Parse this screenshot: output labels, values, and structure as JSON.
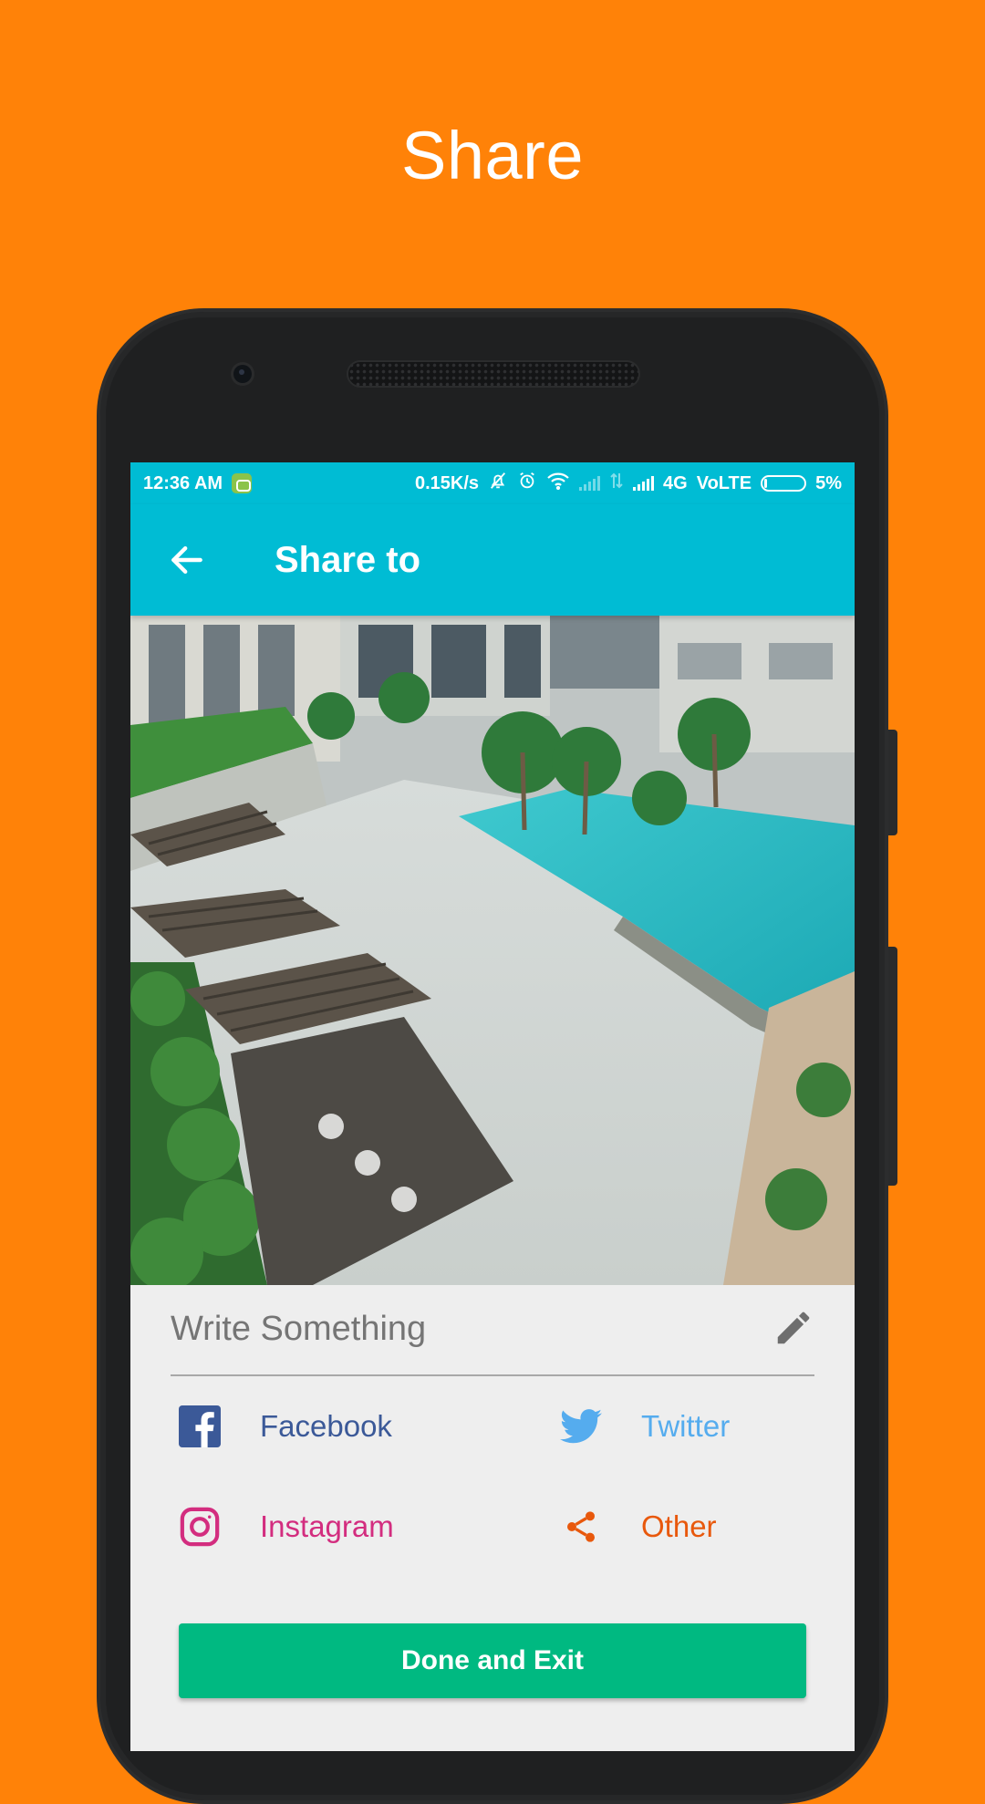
{
  "headline": "Share",
  "status_bar": {
    "time": "12:36 AM",
    "speed": "0.15K/s",
    "network": "4G",
    "volte": "VoLTE",
    "battery": "5%",
    "icons": [
      "android-bot-icon",
      "bell-off-icon",
      "alarm-icon",
      "wifi-icon",
      "signal-icon",
      "data-arrows-icon",
      "battery-icon"
    ]
  },
  "app_bar": {
    "title": "Share to",
    "back_icon": "arrow-left-icon"
  },
  "photo": {
    "icon": "shared-photo"
  },
  "caption": {
    "placeholder": "Write Something",
    "value": "",
    "edit_icon": "pencil-icon"
  },
  "share_options": [
    {
      "label": "Facebook",
      "icon": "facebook-icon",
      "color": "#3B5998"
    },
    {
      "label": "Twitter",
      "icon": "twitter-icon",
      "color": "#55ACEE"
    },
    {
      "label": "Instagram",
      "icon": "instagram-icon",
      "color": "#D32D7F"
    },
    {
      "label": "Other",
      "icon": "share-icon",
      "color": "#E8580C"
    }
  ],
  "done_button": {
    "label": "Done and Exit",
    "color": "#00B981"
  },
  "colors": {
    "background": "#FF8208",
    "app_bar": "#00BCD4"
  }
}
